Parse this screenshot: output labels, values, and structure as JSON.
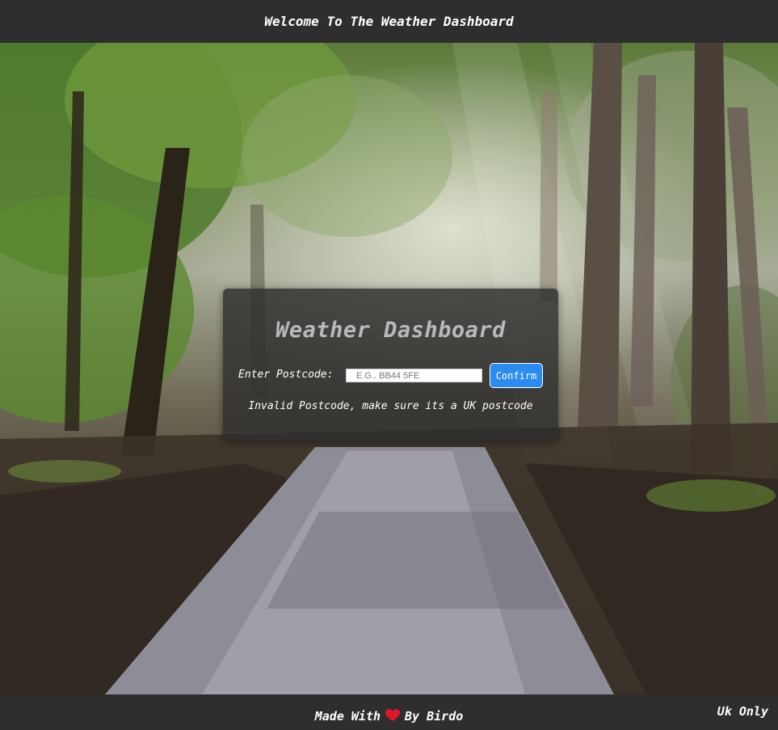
{
  "header": {
    "title": "Welcome To The Weather Dashboard"
  },
  "card": {
    "title": "Weather Dashboard",
    "postcode_label": "Enter Postcode:",
    "postcode_placeholder": "E.G.. BB44 5FE",
    "postcode_value": "",
    "confirm_label": "Confirm",
    "error_message": "Invalid Postcode, make sure its a UK postcode"
  },
  "footer": {
    "made_with": "Made With",
    "by": "By Birdo",
    "region": "Uk Only",
    "heart_icon": "heart-icon"
  },
  "colors": {
    "bar_background": "#2e2e2e",
    "card_background": "#2d2d2d",
    "button_blue": "#2b8bf0",
    "heart_red": "#e0162b"
  }
}
